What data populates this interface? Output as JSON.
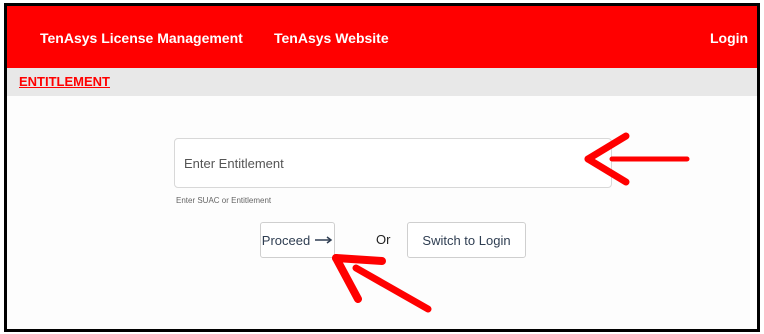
{
  "navbar": {
    "brand": "TenAsys License Management",
    "website_link": "TenAsys Website",
    "login_link": "Login"
  },
  "subnav": {
    "active_tab": "ENTITLEMENT"
  },
  "form": {
    "entitlement_placeholder": "Enter Entitlement",
    "entitlement_value": "",
    "helper_text": "Enter SUAC or Entitlement",
    "proceed_label": "Proceed",
    "proceed_icon": "arrow-right-icon",
    "or_text": "Or",
    "switch_label": "Switch to Login"
  },
  "colors": {
    "brand_red": "#ff0000",
    "subnav_bg": "#e8e8e8",
    "annotation_arrow": "#ff0000"
  }
}
